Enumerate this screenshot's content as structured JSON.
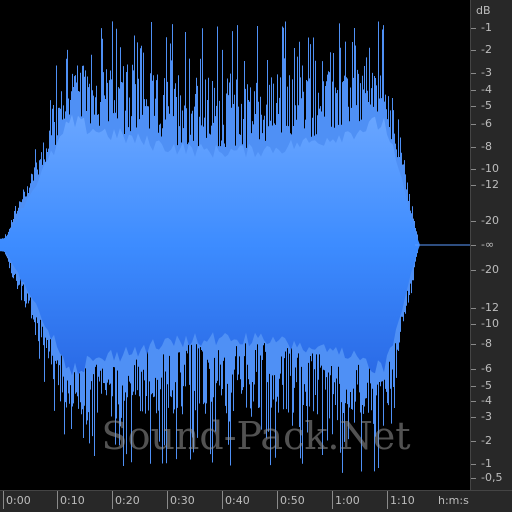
{
  "colors": {
    "waveform_light": "#5b9bff",
    "waveform_dark": "#2f6fe8",
    "background": "#000000",
    "ruler_bg": "#282828",
    "ruler_text": "#bdbdbd"
  },
  "db_ruler": {
    "unit": "dB",
    "labels": [
      "-1",
      "-2",
      "-3",
      "-4",
      "-5",
      "-6",
      "-8",
      "-10",
      "-12",
      "-20",
      "-∞",
      "-20",
      "-12",
      "-10",
      "-8",
      "-6",
      "-5",
      "-4",
      "-3",
      "-2",
      "-1",
      "-0,5"
    ]
  },
  "time_ruler": {
    "unit": "h:m:s",
    "labels": [
      "0:00",
      "0:10",
      "0:20",
      "0:30",
      "0:40",
      "0:50",
      "1:00",
      "1:10"
    ]
  },
  "watermark": "Sound-Pack.Net"
}
